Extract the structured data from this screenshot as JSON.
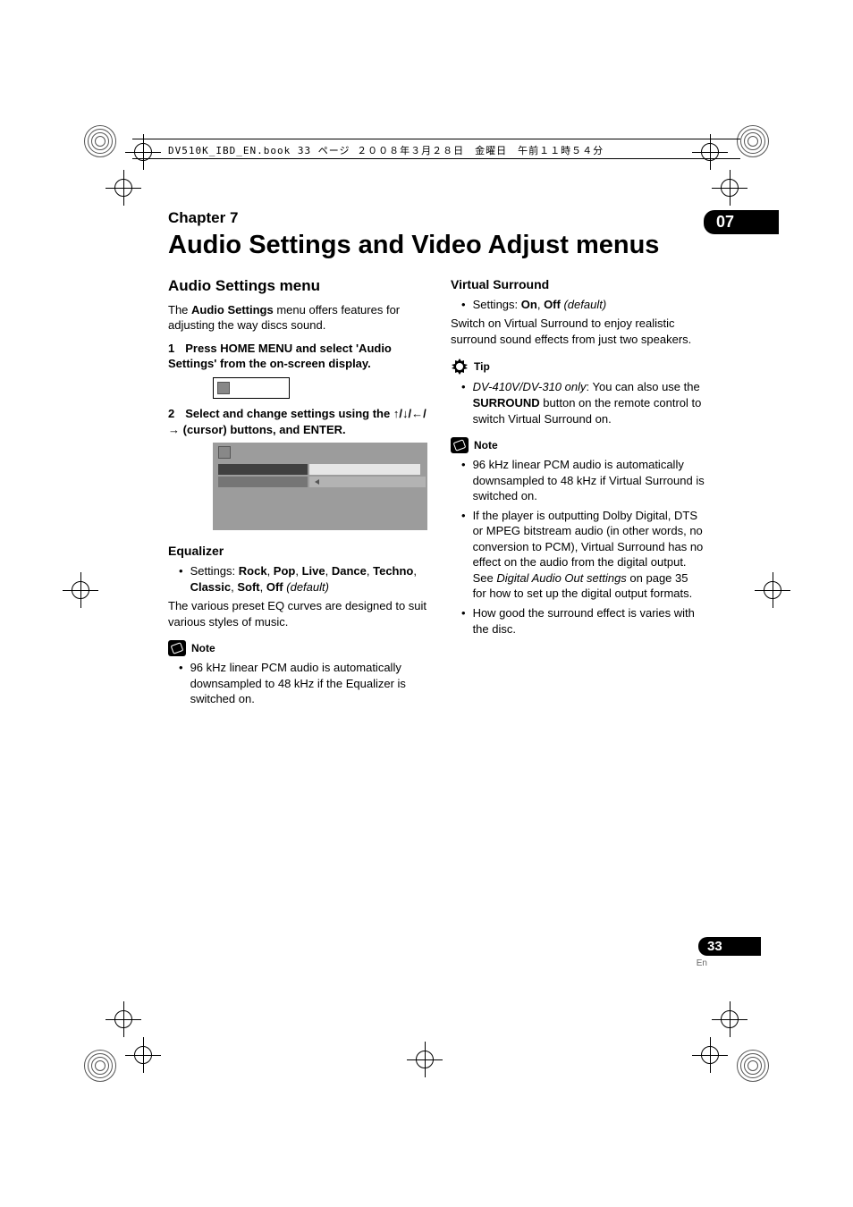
{
  "printHeader": "DV510K_IBD_EN.book  33 ページ  ２００８年３月２８日　金曜日　午前１１時５４分",
  "chapter": {
    "label": "Chapter 7",
    "badge": "07",
    "title": "Audio Settings and Video Adjust menus"
  },
  "left": {
    "heading": "Audio Settings menu",
    "intro_pre": "The ",
    "intro_bold": "Audio Settings",
    "intro_post": " menu offers features for adjusting the way discs sound.",
    "step1_num": "1",
    "step1": "Press HOME MENU and select 'Audio Settings' from the on-screen display.",
    "step2_num": "2",
    "step2_pre": "Select and change settings using the ",
    "step2_post": " (cursor) buttons, and ENTER.",
    "arrows": "↑/↓/←/→",
    "eq_heading": "Equalizer",
    "eq_settings_label": "Settings: ",
    "eq_options": [
      "Rock",
      "Pop",
      "Live",
      "Dance",
      "Techno",
      "Classic",
      "Soft",
      "Off"
    ],
    "eq_default": "(default)",
    "eq_desc": "The various preset EQ curves are designed to suit various styles of music.",
    "note_label": "Note",
    "note1": "96 kHz linear PCM audio is automatically downsampled to 48 kHz if the Equalizer is switched on."
  },
  "right": {
    "vs_heading": "Virtual Surround",
    "vs_settings_label": "Settings: ",
    "vs_on": "On",
    "vs_off": "Off",
    "vs_default": "(default)",
    "vs_desc": "Switch on Virtual Surround to enjoy realistic surround sound effects from just two speakers.",
    "tip_label": "Tip",
    "tip_pre_i": "DV-410V/DV-310 only",
    "tip_pre": ": You can also use the ",
    "tip_bold": "SURROUND",
    "tip_post": " button on the remote control to switch Virtual Surround on.",
    "note_label": "Note",
    "note1": "96 kHz linear PCM audio is automatically downsampled to 48 kHz if Virtual Surround is switched on.",
    "note2_pre": "If the player is outputting Dolby Digital, DTS or MPEG bitstream audio (in other words, no conversion to PCM), Virtual Surround has no effect on the audio from the digital output. See ",
    "note2_i": "Digital Audio Out settings",
    "note2_post": " on page 35 for how to set up the digital output formats.",
    "note3": "How good the surround effect is varies with the disc."
  },
  "pageNumber": "33",
  "pageLang": "En"
}
